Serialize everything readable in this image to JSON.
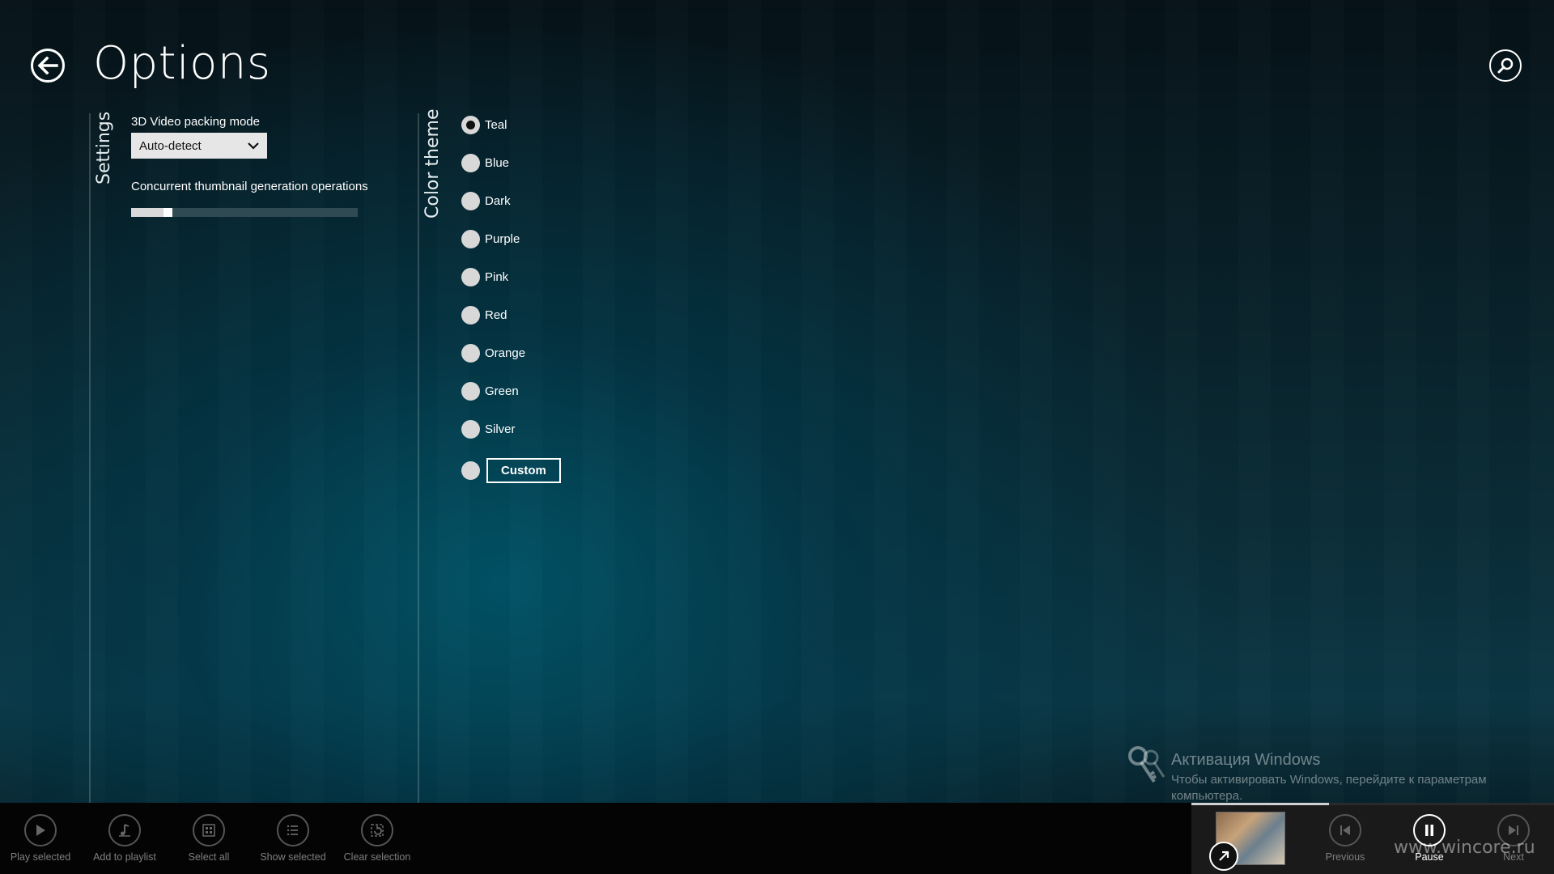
{
  "header": {
    "title": "Options",
    "back_icon": "back-arrow-icon",
    "search_icon": "search-icon"
  },
  "settings": {
    "section_label": "Settings",
    "packing_mode_label": "3D Video packing mode",
    "packing_mode_value": "Auto-detect",
    "thumbnail_ops_label": "Concurrent thumbnail generation operations",
    "thumbnail_ops_slider_fraction": 0.15
  },
  "color_theme": {
    "section_label": "Color theme",
    "selected": "Teal",
    "options": [
      "Teal",
      "Blue",
      "Dark",
      "Purple",
      "Pink",
      "Red",
      "Orange",
      "Green",
      "Silver"
    ],
    "custom_label": "Custom"
  },
  "activation": {
    "title": "Активация Windows",
    "text": "Чтобы активировать Windows, перейдите к параметрам компьютера."
  },
  "appbar": {
    "play_selected": "Play selected",
    "add_to_playlist": "Add to playlist",
    "select_all": "Select all",
    "show_selected": "Show selected",
    "clear_selection": "Clear selection"
  },
  "now_playing": {
    "progress_fraction": 0.38,
    "previous": "Previous",
    "pause": "Pause",
    "next": "Next"
  },
  "watermark": "www.wincore.ru",
  "colors": {
    "accent_teal": "#0b3644",
    "appbar_bg": "#040404",
    "control_bg": "#e6e6e6"
  }
}
